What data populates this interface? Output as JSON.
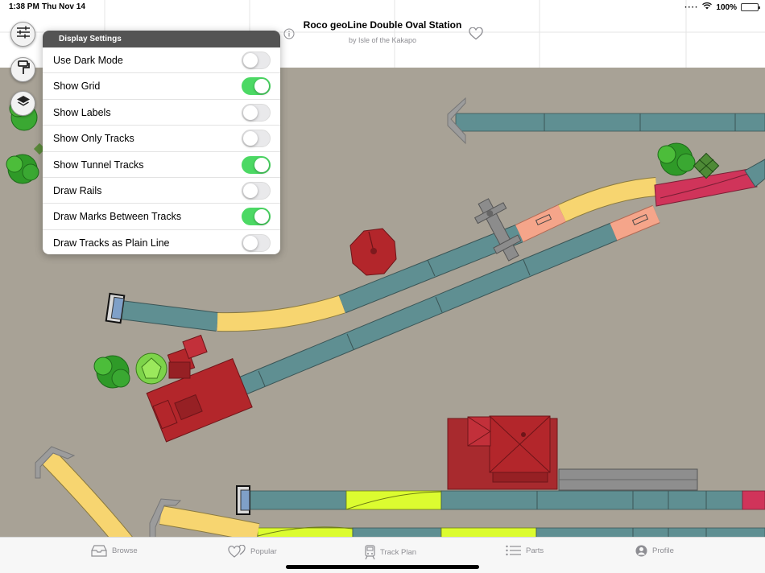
{
  "status_bar": {
    "time": "1:38 PM",
    "date": "Thu Nov 14",
    "battery": "100%"
  },
  "header": {
    "title": "Roco geoLine Double Oval Station",
    "subtitle": "by Isle of the Kakapo"
  },
  "toolbar": {
    "settings_icon": "sliders-icon",
    "paint_icon": "paint-roller-icon",
    "layers_icon": "layers-icon"
  },
  "display_settings": {
    "title": "Display Settings",
    "options": [
      {
        "label": "Use Dark Mode",
        "enabled": false
      },
      {
        "label": "Show Grid",
        "enabled": true
      },
      {
        "label": "Show Labels",
        "enabled": false
      },
      {
        "label": "Show Only Tracks",
        "enabled": false
      },
      {
        "label": "Show Tunnel Tracks",
        "enabled": true
      },
      {
        "label": "Draw Rails",
        "enabled": false
      },
      {
        "label": "Draw Marks Between Tracks",
        "enabled": true
      },
      {
        "label": "Draw Tracks as Plain Line",
        "enabled": false
      }
    ]
  },
  "tabs": [
    {
      "label": "Browse",
      "icon": "tray-icon"
    },
    {
      "label": "Popular",
      "icon": "hearts-icon"
    },
    {
      "label": "Track Plan",
      "icon": "train-icon"
    },
    {
      "label": "Parts",
      "icon": "list-icon"
    },
    {
      "label": "Profile",
      "icon": "person-circle-icon"
    }
  ],
  "colors": {
    "accent_green": "#4cd964",
    "canvas_background": "#a8a296",
    "track_straight": "#5f8f92",
    "track_curve": "#f7d570",
    "track_switch": "#d0345a",
    "track_turnout_yellow": "#dcfc30",
    "track_buffer": "#f5a58a",
    "building_red": "#b3262b"
  }
}
